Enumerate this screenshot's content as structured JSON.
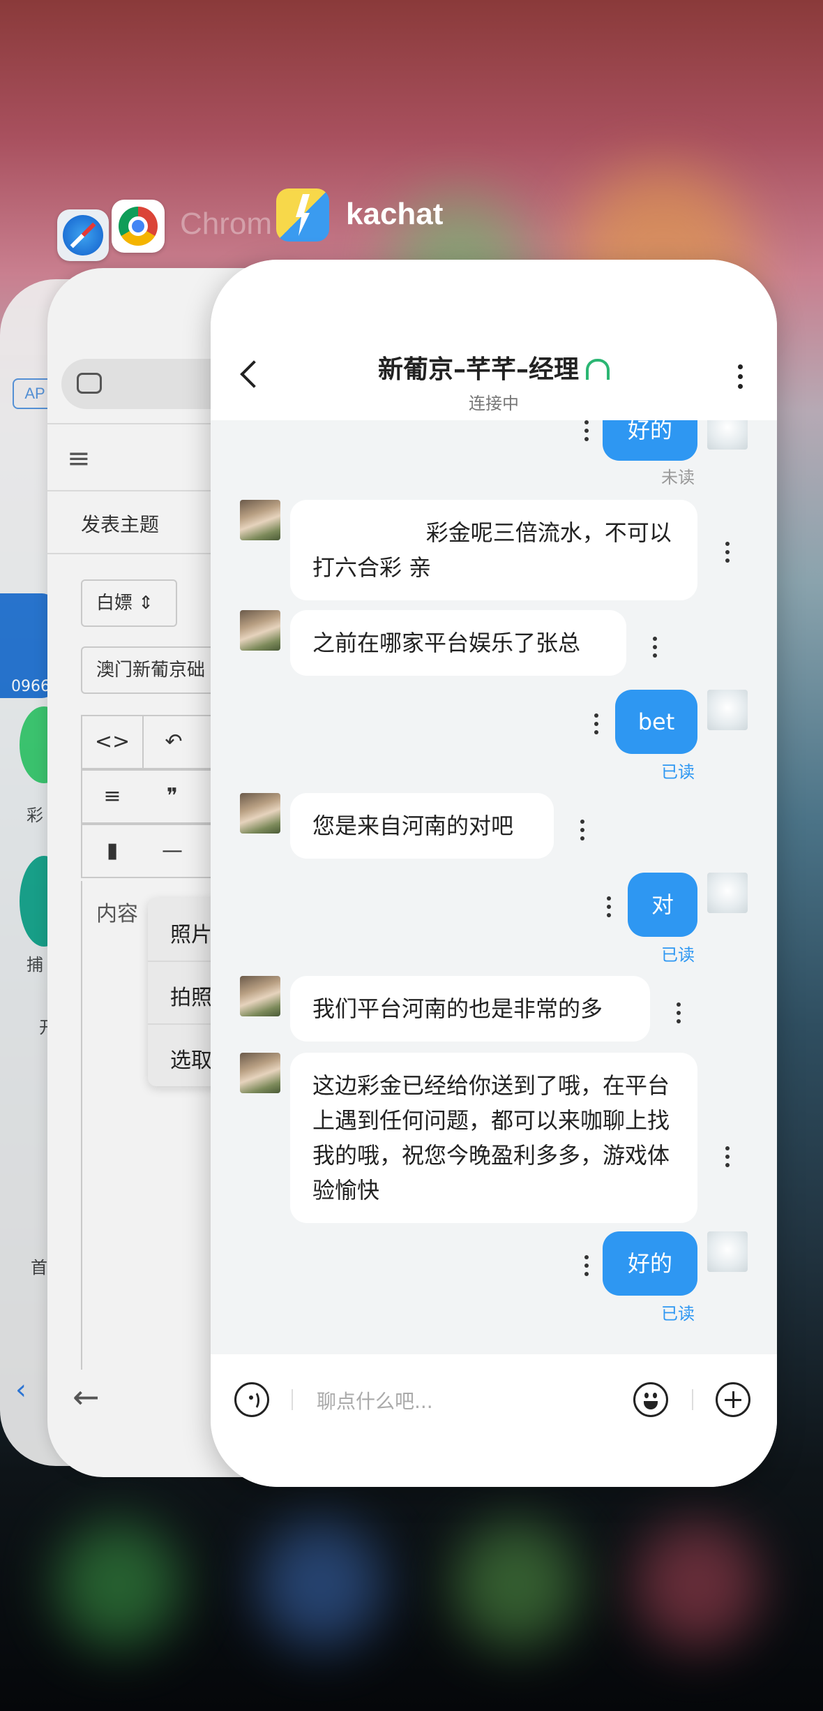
{
  "switcher": {
    "chrome_label": "Chrom",
    "kachat_label": "kachat"
  },
  "back_card_1": {
    "app_badge": "AP",
    "phone_fragment": "0966",
    "label_cai": "彩",
    "label_bu": "捕",
    "label_kai": "开",
    "label_home": "首"
  },
  "back_card_2": {
    "post_title": "发表主题",
    "select_value": "白嫖",
    "title_input_value": "澳门新葡京础",
    "content_label": "内容",
    "popup_items": [
      "照片",
      "拍照",
      "选取"
    ],
    "toolbar_row1": [
      "<>",
      "↶"
    ],
    "toolbar_row2": [
      "≡",
      "❞"
    ],
    "toolbar_row3": [
      "—"
    ]
  },
  "chat": {
    "title": "新葡京–芊芊–经理",
    "status": "连接中",
    "input_placeholder": "聊点什么吧...",
    "messages": [
      {
        "side": "right",
        "text": "好的",
        "status": "未读"
      },
      {
        "side": "left",
        "text": "                彩金呢三倍流水，不可以打六合彩 亲"
      },
      {
        "side": "left",
        "text": "之前在哪家平台娱乐了张总"
      },
      {
        "side": "right",
        "text": "bet",
        "status": "已读"
      },
      {
        "side": "left",
        "text": "您是来自河南的对吧"
      },
      {
        "side": "right",
        "text": "对",
        "status": "已读"
      },
      {
        "side": "left",
        "text": "我们平台河南的也是非常的多"
      },
      {
        "side": "left",
        "text": "这边彩金已经给你送到了哦，在平台上遇到任何问题，都可以来咖聊上找我的哦，祝您今晚盈利多多，游戏体验愉快"
      },
      {
        "side": "right",
        "text": "好的",
        "status": "已读"
      }
    ]
  }
}
